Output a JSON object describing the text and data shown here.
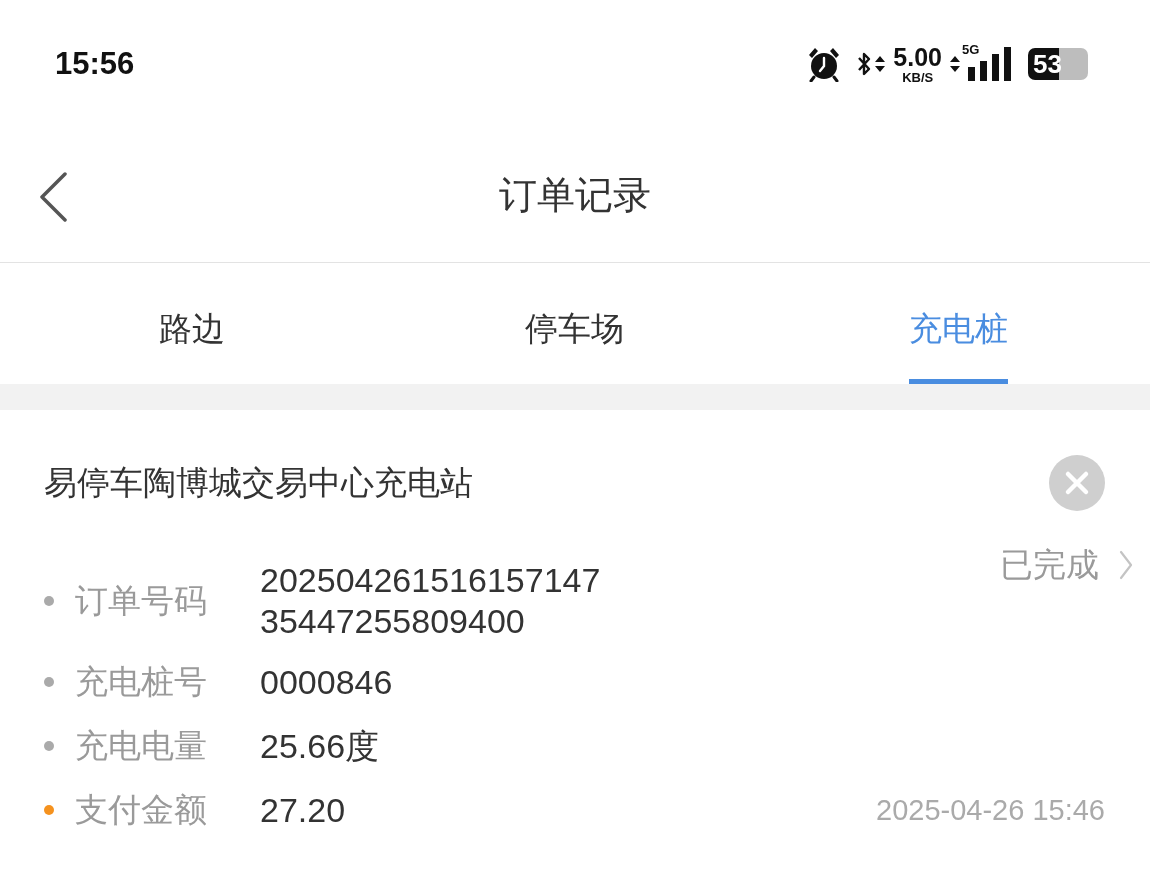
{
  "status_bar": {
    "time": "15:56",
    "net_speed": "5.00",
    "net_speed_unit": "KB/S",
    "network_type": "5G",
    "battery": "53"
  },
  "header": {
    "title": "订单记录"
  },
  "tabs": [
    {
      "label": "路边",
      "selected": false
    },
    {
      "label": "停车场",
      "selected": false
    },
    {
      "label": "充电桩",
      "selected": true
    }
  ],
  "order": {
    "station": "易停车陶博城交易中心充电站",
    "status": "已完成",
    "fields": [
      {
        "label": "订单号码",
        "value": "20250426151615714735447255809400",
        "color": "#aaaaaa"
      },
      {
        "label": "充电桩号",
        "value": "0000846",
        "color": "#aaaaaa"
      },
      {
        "label": "充电电量",
        "value": "25.66度",
        "color": "#aaaaaa"
      },
      {
        "label": "支付金额",
        "value": "27.20",
        "color": "#f5921e"
      }
    ],
    "time": "2025-04-26 15:46"
  }
}
